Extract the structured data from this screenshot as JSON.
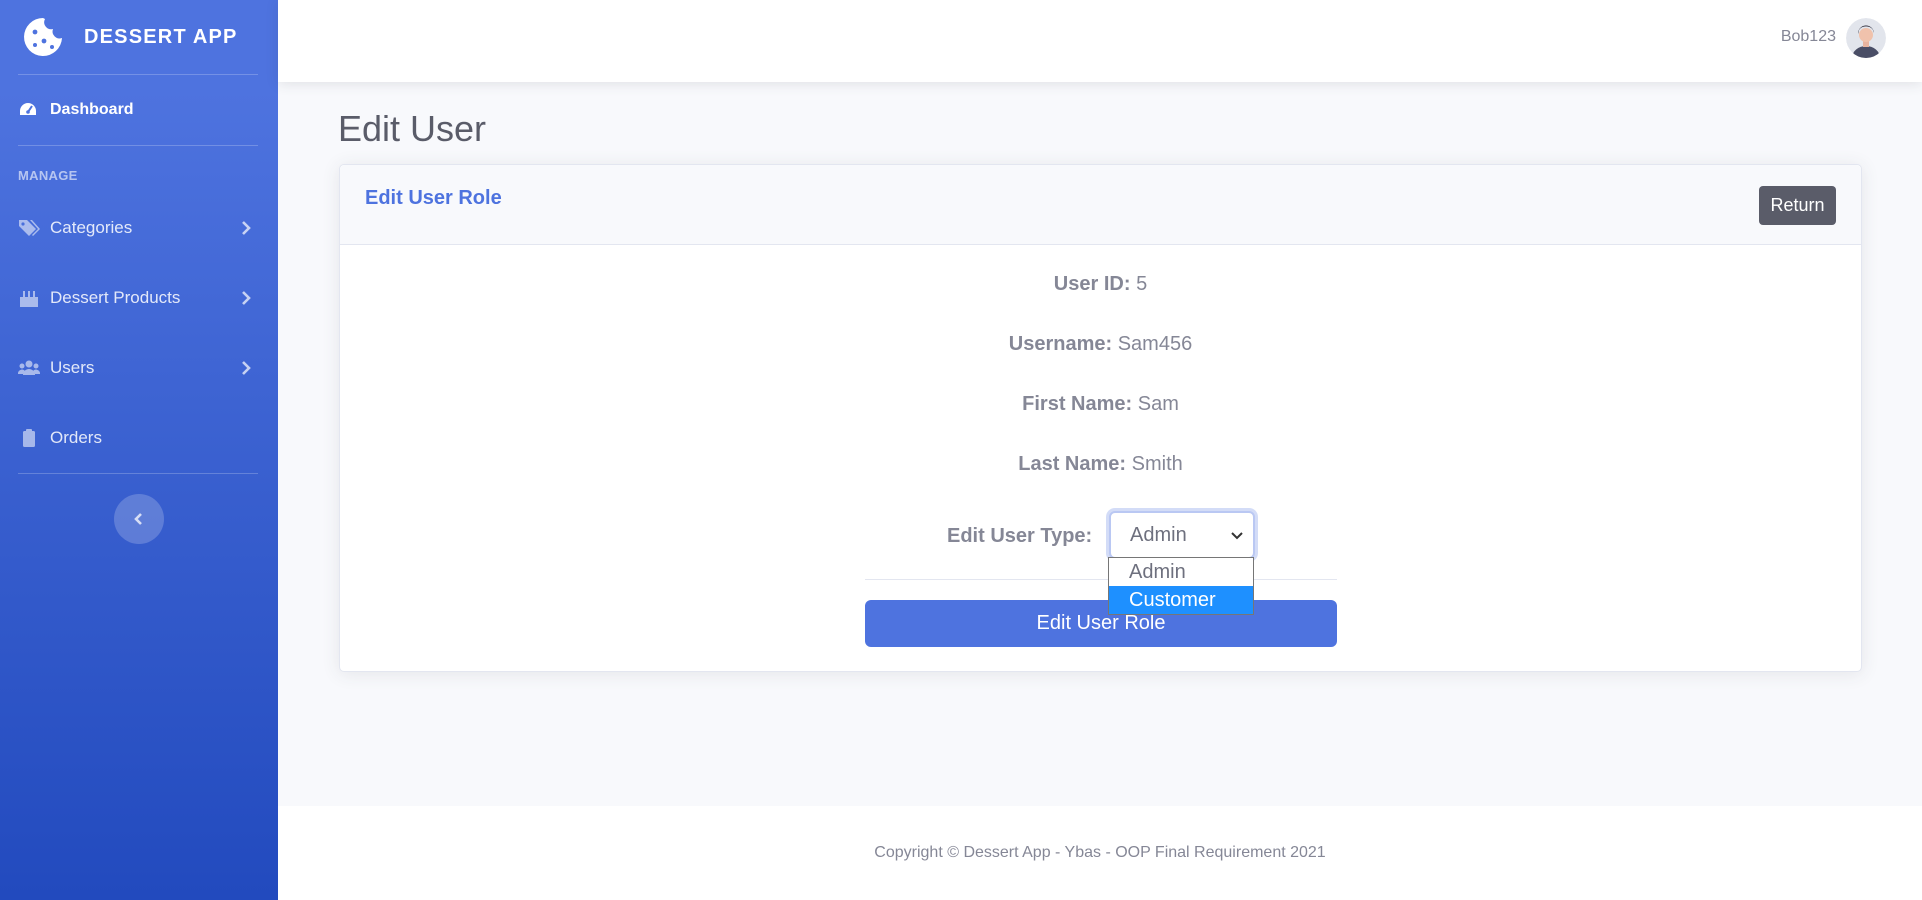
{
  "brand": {
    "name": "DESSERT APP",
    "logo_icon": "cookie-icon"
  },
  "sidebar": {
    "dashboard": {
      "label": "Dashboard",
      "icon": "tachometer-icon"
    },
    "heading": "MANAGE",
    "items": [
      {
        "label": "Categories",
        "icon": "tags-icon",
        "has_submenu": true
      },
      {
        "label": "Dessert Products",
        "icon": "birthday-cake-icon",
        "has_submenu": true
      },
      {
        "label": "Users",
        "icon": "users-icon",
        "has_submenu": true
      },
      {
        "label": "Orders",
        "icon": "clipboard-icon",
        "has_submenu": false
      }
    ],
    "toggle_icon": "chevron-left-icon"
  },
  "topbar": {
    "username": "Bob123",
    "avatar_icon": "user-avatar"
  },
  "page": {
    "title": "Edit User"
  },
  "card": {
    "title": "Edit User Role",
    "return_label": "Return",
    "user_id_label": "User ID:",
    "user_id": "5",
    "username_label": "Username:",
    "username": "Sam456",
    "first_name_label": "First Name:",
    "first_name": "Sam",
    "last_name_label": "Last Name:",
    "last_name": "Smith",
    "type_label": "Edit User Type:",
    "type_selected": "Admin",
    "type_options": [
      "Admin",
      "Customer"
    ],
    "type_highlighted": "Customer",
    "submit_label": "Edit User Role"
  },
  "footer": {
    "copyright": "Copyright © Dessert App - Ybas - OOP Final Requirement 2021"
  },
  "colors": {
    "primary": "#4e73df",
    "primary_dark": "#224abe",
    "text_muted": "#858796",
    "secondary_btn": "#5a5c69",
    "highlight": "#1e90ff"
  }
}
